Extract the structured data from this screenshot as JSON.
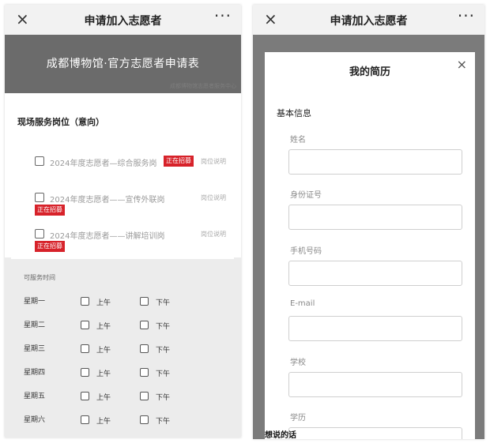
{
  "left": {
    "header": {
      "close_icon": "×",
      "title": "申请加入志愿者",
      "more_icon": "···"
    },
    "banner": {
      "title": "成都博物馆·官方志愿者申请表",
      "faint": "成都博物馆志愿者服务中心"
    },
    "section_title": "现场服务岗位（意向）",
    "jobs": [
      {
        "name": "2024年度志愿者—综合服务岗",
        "badge": "正在招募",
        "desc": "岗位说明"
      },
      {
        "name": "2024年度志愿者——宣传外联岗",
        "badge": "正在招募",
        "desc": "岗位说明"
      },
      {
        "name": "2024年度志愿者——讲解培训岗",
        "badge": "正在招募",
        "desc": "岗位说明"
      }
    ],
    "time": {
      "label": "可服务时间",
      "am": "上午",
      "pm": "下午",
      "days": [
        "星期一",
        "星期二",
        "星期三",
        "星期四",
        "星期五",
        "星期六"
      ]
    }
  },
  "right": {
    "header": {
      "close_icon": "×",
      "title": "申请加入志愿者",
      "more_icon": "···"
    },
    "modal": {
      "title": "我的简历",
      "close_icon": "×",
      "section": "基本信息",
      "fields": [
        "姓名",
        "身份证号",
        "手机号码",
        "E-mail",
        "学校",
        "学历"
      ]
    },
    "bottom_text": "想说的话"
  }
}
